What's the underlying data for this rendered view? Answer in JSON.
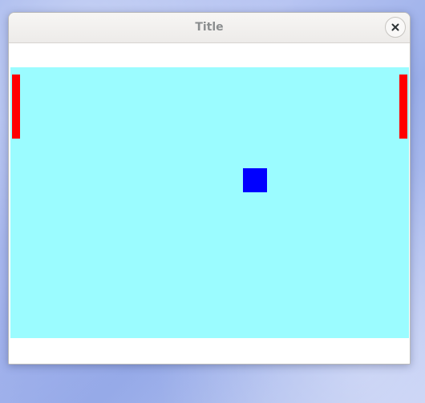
{
  "window": {
    "title": "Title",
    "close_icon": "close-icon"
  },
  "game": {
    "playfield_color": "#9bfcff",
    "paddle_color": "#ff0000",
    "ball_color": "#0000ff"
  }
}
